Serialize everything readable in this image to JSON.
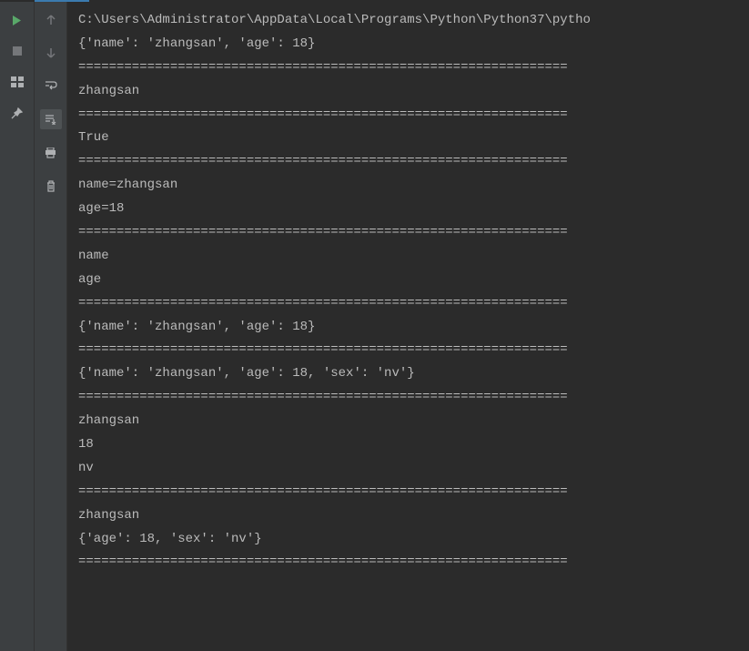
{
  "console": {
    "lines": [
      "C:\\Users\\Administrator\\AppData\\Local\\Programs\\Python\\Python37\\pytho",
      "{'name': 'zhangsan', 'age': 18}",
      "================================================================",
      "zhangsan",
      "================================================================",
      "True",
      "================================================================",
      "name=zhangsan",
      "age=18",
      "================================================================",
      "name",
      "age",
      "================================================================",
      "{'name': 'zhangsan', 'age': 18}",
      "================================================================",
      "{'name': 'zhangsan', 'age': 18, 'sex': 'nv'}",
      "================================================================",
      "zhangsan",
      "18",
      "nv",
      "================================================================",
      "zhangsan",
      "{'age': 18, 'sex': 'nv'}",
      "================================================================"
    ]
  }
}
